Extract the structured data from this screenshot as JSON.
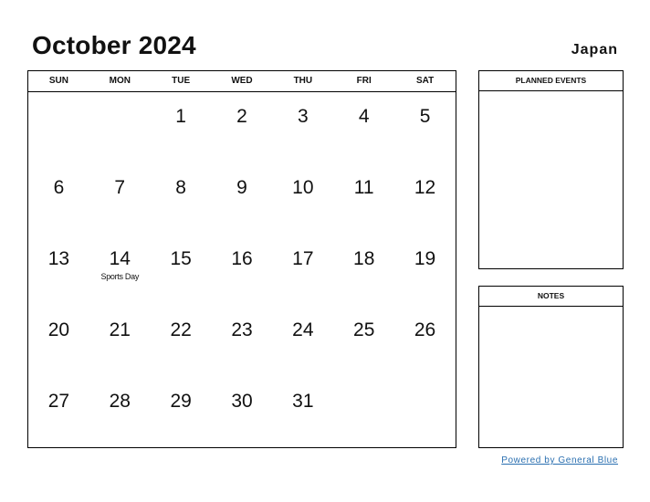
{
  "header": {
    "title": "October 2024",
    "country": "Japan"
  },
  "weekdays": [
    "SUN",
    "MON",
    "TUE",
    "WED",
    "THU",
    "FRI",
    "SAT"
  ],
  "weeks": [
    [
      {
        "d": ""
      },
      {
        "d": ""
      },
      {
        "d": "1"
      },
      {
        "d": "2"
      },
      {
        "d": "3"
      },
      {
        "d": "4"
      },
      {
        "d": "5"
      }
    ],
    [
      {
        "d": "6"
      },
      {
        "d": "7"
      },
      {
        "d": "8"
      },
      {
        "d": "9"
      },
      {
        "d": "10"
      },
      {
        "d": "11"
      },
      {
        "d": "12"
      }
    ],
    [
      {
        "d": "13"
      },
      {
        "d": "14",
        "h": "Sports Day"
      },
      {
        "d": "15"
      },
      {
        "d": "16"
      },
      {
        "d": "17"
      },
      {
        "d": "18"
      },
      {
        "d": "19"
      }
    ],
    [
      {
        "d": "20"
      },
      {
        "d": "21"
      },
      {
        "d": "22"
      },
      {
        "d": "23"
      },
      {
        "d": "24"
      },
      {
        "d": "25"
      },
      {
        "d": "26"
      }
    ],
    [
      {
        "d": "27"
      },
      {
        "d": "28"
      },
      {
        "d": "29"
      },
      {
        "d": "30"
      },
      {
        "d": "31"
      },
      {
        "d": ""
      },
      {
        "d": ""
      }
    ]
  ],
  "panels": {
    "events_title": "PLANNED EVENTS",
    "notes_title": "NOTES"
  },
  "footer": {
    "powered": "Powered by General Blue",
    "link_color": "#2a6fb0"
  }
}
